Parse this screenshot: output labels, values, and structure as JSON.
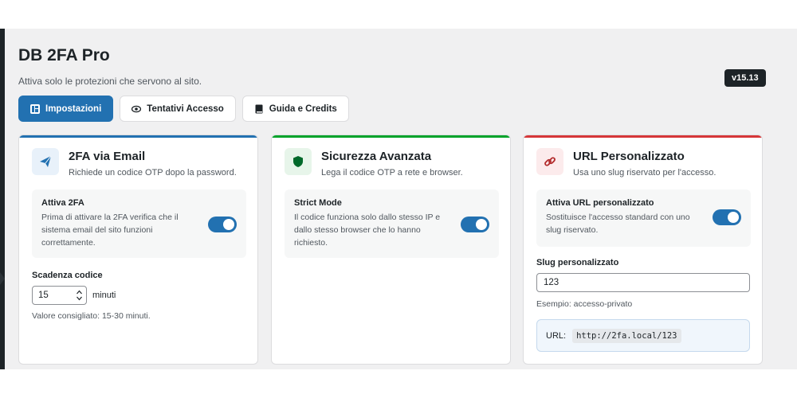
{
  "app": {
    "title": "DB 2FA Pro",
    "subtitle": "Attiva solo le protezioni che servono al sito.",
    "version": "v15.13"
  },
  "tabs": [
    {
      "label": "Impostazioni",
      "icon": "dashboard-icon",
      "active": true
    },
    {
      "label": "Tentativi Accesso",
      "icon": "eye-icon",
      "active": false
    },
    {
      "label": "Guida e Credits",
      "icon": "book-icon",
      "active": false
    }
  ],
  "cards": {
    "email": {
      "title": "2FA via Email",
      "description": "Richiede un codice OTP dopo la password.",
      "accent": "#2271b1",
      "icon": "paper-plane-icon",
      "setting": {
        "title": "Attiva 2FA",
        "text": "Prima di attivare la 2FA verifica che il sistema email del sito funzioni correttamente.",
        "enabled": true
      },
      "expiry": {
        "label": "Scadenza codice",
        "value": "15",
        "unit": "minuti",
        "hint": "Valore consigliato: 15-30 minuti."
      }
    },
    "security": {
      "title": "Sicurezza Avanzata",
      "description": "Lega il codice OTP a rete e browser.",
      "accent": "#00a32a",
      "icon": "shield-icon",
      "setting": {
        "title": "Strict Mode",
        "text": "Il codice funziona solo dallo stesso IP e dallo stesso browser che lo hanno richiesto.",
        "enabled": true
      }
    },
    "url": {
      "title": "URL Personalizzato",
      "description": "Usa uno slug riservato per l'accesso.",
      "accent": "#d63638",
      "icon": "link-icon",
      "setting": {
        "title": "Attiva URL personalizzato",
        "text": "Sostituisce l'accesso standard con uno slug riservato.",
        "enabled": true
      },
      "slug": {
        "label": "Slug personalizzato",
        "value": "123",
        "hint": "Esempio: accesso-privato"
      },
      "preview": {
        "label": "URL:",
        "value": "http://2fa.local/123"
      }
    }
  }
}
